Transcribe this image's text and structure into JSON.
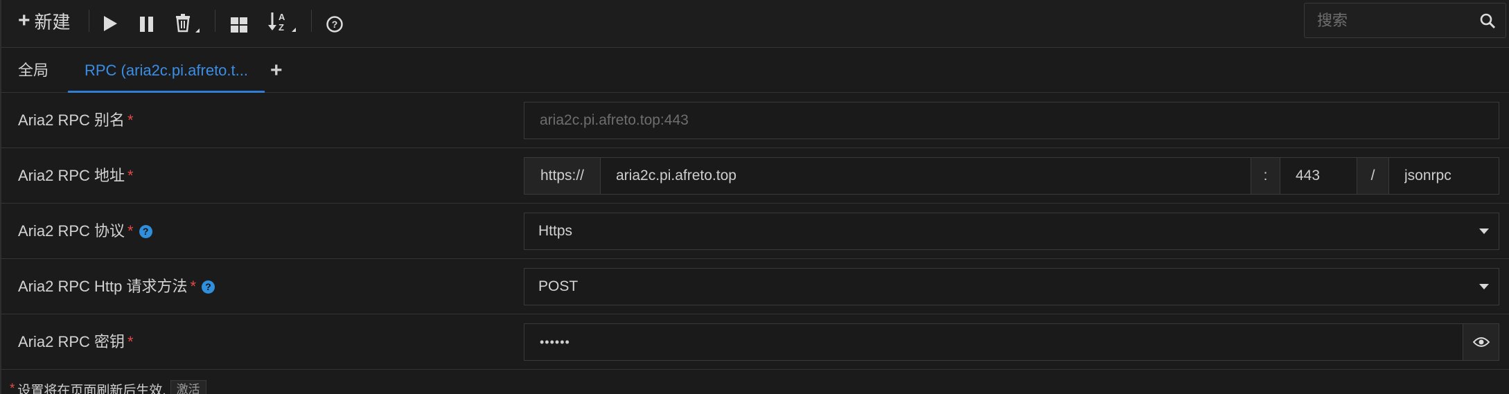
{
  "toolbar": {
    "new_icon": "plus-icon",
    "new_label": "新建",
    "start_icon": "play-icon",
    "pause_icon": "pause-icon",
    "delete_icon": "trash-icon",
    "select_icon": "grid-icon",
    "sort_icon": "sort-az-icon",
    "help_icon": "question-circle-icon"
  },
  "search": {
    "placeholder": "搜索",
    "icon": "search-icon"
  },
  "tabs": {
    "global_label": "全局",
    "rpc_label": "RPC (aria2c.pi.afreto.t...",
    "add_label": "+"
  },
  "form": {
    "alias": {
      "label": "Aria2 RPC 别名",
      "required_mark": "*",
      "placeholder": "aria2c.pi.afreto.top:443",
      "value": ""
    },
    "address": {
      "label": "Aria2 RPC 地址",
      "required_mark": "*",
      "protocol_prefix": "https://",
      "host": "aria2c.pi.afreto.top",
      "port_separator": ":",
      "port": "443",
      "path_separator": "/",
      "path": "jsonrpc"
    },
    "protocol": {
      "label": "Aria2 RPC 协议",
      "required_mark": "*",
      "help": "?",
      "selected": "Https"
    },
    "method": {
      "label": "Aria2 RPC Http 请求方法",
      "required_mark": "*",
      "help": "?",
      "selected": "POST"
    },
    "secret": {
      "label": "Aria2 RPC 密钥",
      "required_mark": "*",
      "value": "••••••",
      "toggle_icon": "eye-icon"
    }
  },
  "footer": {
    "required_mark": "*",
    "note": "设置将在页面刷新后生效,",
    "activate_label": "激活"
  },
  "colors": {
    "accent": "#3a8ee6",
    "required": "#e04a4a",
    "help_badge": "#2f8fdc",
    "background": "#1b1b1b"
  }
}
